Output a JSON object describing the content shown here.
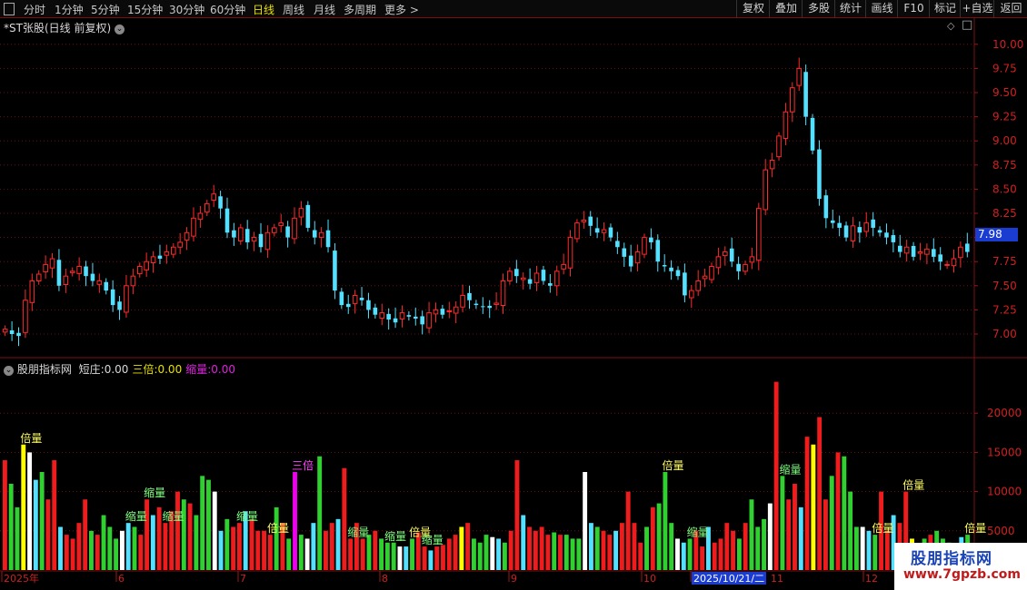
{
  "toolbar": {
    "periods": [
      "分时",
      "1分钟",
      "5分钟",
      "15分钟",
      "30分钟",
      "60分钟",
      "日线",
      "周线",
      "月线",
      "多周期",
      "更多 >"
    ],
    "active_period": "日线",
    "right_buttons": [
      "复权",
      "叠加",
      "多股",
      "统计",
      "画线",
      "F10",
      "标记",
      "+自选",
      "返回"
    ]
  },
  "main_panel": {
    "title": "*ST张股(日线 前复权)",
    "current_price_tag": "7.98",
    "y_ticks": [
      "10.00",
      "9.75",
      "9.50",
      "9.25",
      "9.00",
      "8.75",
      "8.50",
      "8.25",
      "8.00",
      "7.75",
      "7.50",
      "7.25",
      "7.00"
    ]
  },
  "indicator_panel": {
    "name": "股朋指标网",
    "fields": [
      {
        "label": "短庄:",
        "value": "0.00",
        "color": "#d8d8d8"
      },
      {
        "label": "三倍:",
        "value": "0.00",
        "color": "#e8e000"
      },
      {
        "label": "缩量:",
        "value": "0.00",
        "color": "#e020e0"
      }
    ],
    "y_ticks": [
      "20000",
      "15000",
      "10000",
      "5000"
    ],
    "annotations": [
      "倍量",
      "三倍",
      "缩量"
    ]
  },
  "time_axis": {
    "labels": [
      "2025年",
      "6",
      "7",
      "8",
      "9",
      "10",
      "2025/10/21/二",
      "11",
      "12"
    ]
  },
  "watermark": {
    "title": "股朋指标网",
    "url": "www.7gpzb.com"
  },
  "colors": {
    "up": "#ff2a2a",
    "down": "#54e0ff",
    "vol_up": "#ee1c1c",
    "vol_down": "#30d030",
    "vol_cyan": "#54e0ff",
    "vol_white": "#ffffff",
    "vol_yellow": "#ffff00",
    "vol_magenta": "#ee00ee",
    "grid": "#6a1010",
    "axis_text": "#d02020"
  },
  "chart_data": [
    {
      "type": "candlestick",
      "title": "*ST张股(日线 前复权)",
      "ylim": [
        6.9,
        10.15
      ],
      "close_series": [
        7.05,
        7.0,
        6.98,
        7.35,
        7.55,
        7.62,
        7.72,
        7.78,
        7.5,
        7.6,
        7.65,
        7.7,
        7.6,
        7.55,
        7.55,
        7.45,
        7.3,
        7.25,
        7.5,
        7.6,
        7.7,
        7.75,
        7.8,
        7.78,
        7.85,
        7.9,
        7.95,
        8.05,
        8.2,
        8.25,
        8.35,
        8.45,
        8.3,
        8.05,
        8.0,
        8.1,
        7.95,
        8.0,
        7.9,
        8.05,
        8.1,
        8.15,
        8.0,
        8.2,
        8.3,
        8.1,
        8.0,
        8.05,
        7.9,
        7.45,
        7.3,
        7.28,
        7.4,
        7.35,
        7.25,
        7.2,
        7.22,
        7.15,
        7.12,
        7.22,
        7.18,
        7.16,
        7.1,
        7.22,
        7.25,
        7.2,
        7.24,
        7.28,
        7.4,
        7.35,
        7.3,
        7.28,
        7.27,
        7.32,
        7.55,
        7.65,
        7.6,
        7.58,
        7.52,
        7.63,
        7.55,
        7.5,
        7.65,
        7.72,
        8.0,
        8.15,
        8.18,
        8.12,
        8.05,
        8.08,
        8.0,
        7.9,
        7.8,
        7.7,
        7.85,
        8.0,
        7.95,
        7.75,
        7.7,
        7.65,
        7.6,
        7.4,
        7.45,
        7.55,
        7.6,
        7.7,
        7.8,
        7.85,
        7.75,
        7.65,
        7.72,
        7.8,
        8.3,
        8.7,
        8.8,
        9.05,
        9.3,
        9.55,
        9.75,
        9.25,
        8.9,
        8.4,
        8.2,
        8.15,
        8.1,
        8.0,
        8.12,
        8.05,
        8.15,
        8.1,
        8.05,
        8.0,
        7.95,
        7.85,
        7.9,
        7.8,
        7.85,
        7.88,
        7.8,
        7.75,
        7.72,
        7.78,
        7.9,
        7.85
      ]
    },
    {
      "type": "bar",
      "title": "股朋指标网",
      "ylim": [
        0,
        25000
      ],
      "values": [
        14000,
        11000,
        8000,
        16000,
        15000,
        11500,
        12500,
        9000,
        14000,
        5500,
        4500,
        4000,
        6000,
        9000,
        5000,
        4500,
        7000,
        5500,
        4000,
        5000,
        6000,
        5500,
        4500,
        9000,
        7000,
        8000,
        6000,
        7500,
        10000,
        9000,
        8500,
        7000,
        12000,
        11500,
        10000,
        5000,
        6500,
        5500,
        6000,
        7500,
        6500,
        5000,
        5000,
        4500,
        8000,
        6000,
        4000,
        12500,
        4500,
        4000,
        6000,
        14500,
        5000,
        6000,
        6500,
        13000,
        4000,
        6000,
        4000,
        4500,
        5000,
        4000,
        3500,
        3500,
        3000,
        3000,
        4000,
        4800,
        3000,
        2500,
        3000,
        3200,
        4000,
        4500,
        5500,
        6000,
        4000,
        3500,
        4500,
        4200,
        4000,
        3500,
        5000,
        14000,
        7000,
        5500,
        5000,
        5500,
        4500,
        4800,
        4500,
        4500,
        4000,
        4000,
        12500,
        6000,
        5500,
        5000,
        4500,
        5000,
        6000,
        10000,
        6000,
        3500,
        5500,
        8000,
        8500,
        12500,
        6000,
        4000,
        3500,
        4000,
        5000,
        3000,
        5500,
        3500,
        4000,
        6000,
        5000,
        4000,
        6000,
        9000,
        5500,
        6500,
        8500,
        24000,
        12000,
        9000,
        11000,
        8000,
        17000,
        16000,
        19500,
        9000,
        12000,
        15000,
        14500,
        10000,
        5500,
        5500,
        5000,
        4500,
        10000,
        5000,
        7000,
        6000,
        10000,
        4000,
        3000,
        4000,
        4500,
        5000,
        4000,
        3500,
        2800,
        4200,
        4500
      ]
    }
  ]
}
